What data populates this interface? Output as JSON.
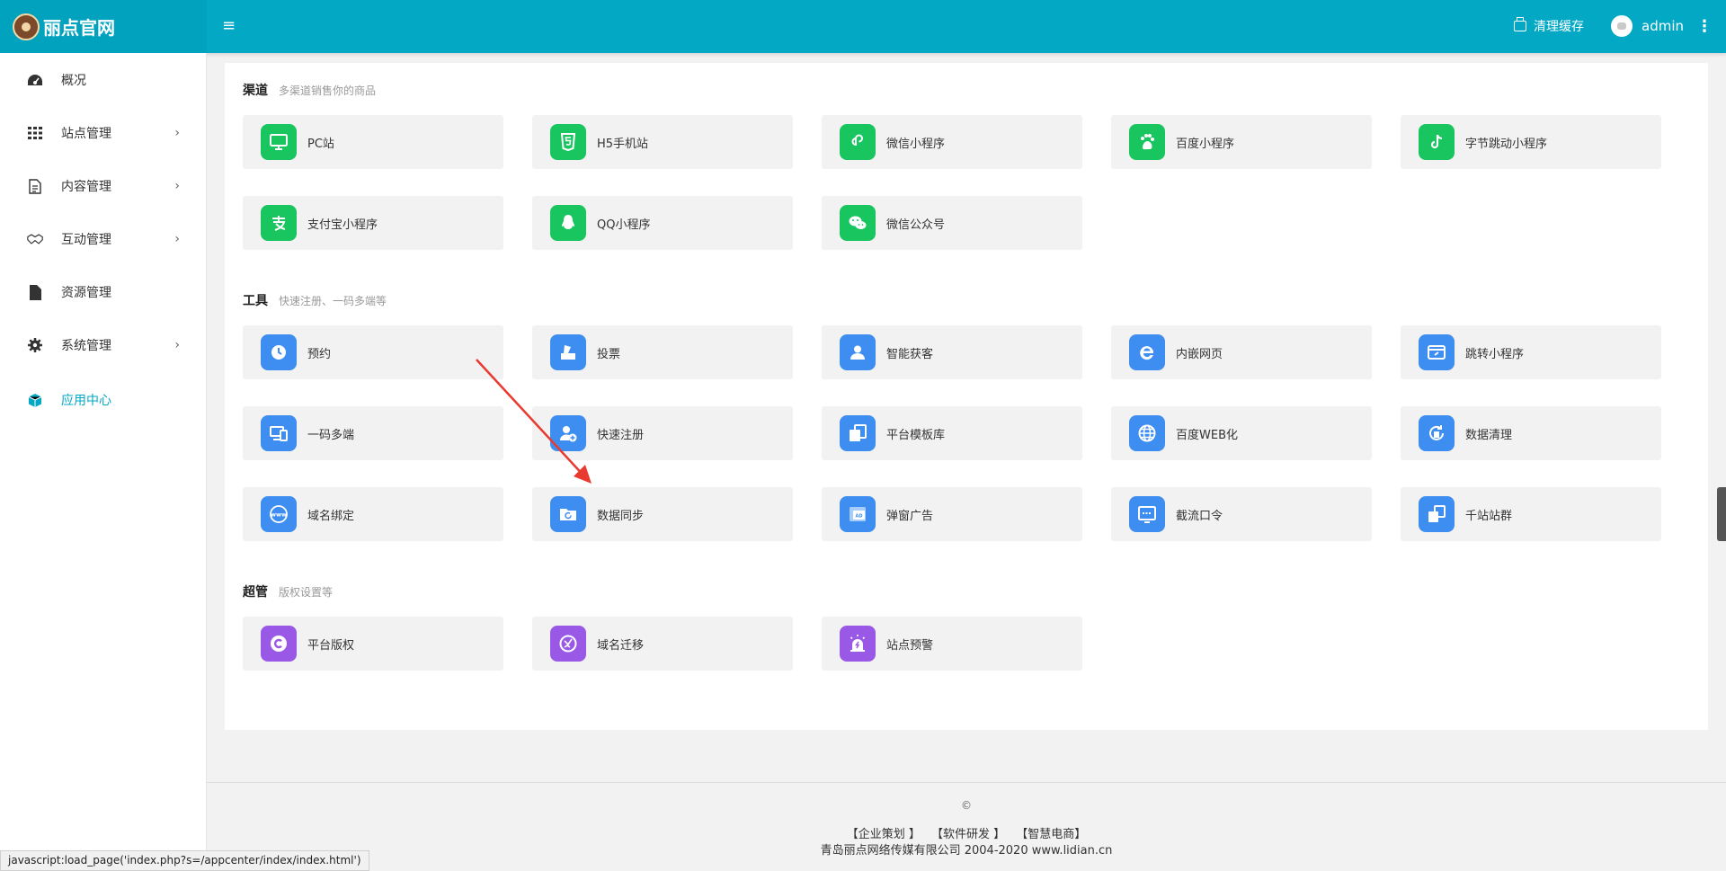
{
  "header": {
    "brand_title": "丽点官网",
    "menu_toggle_icon": "hamburger-icon",
    "clear_cache_label": "清理缓存",
    "user_name": "admin",
    "theme_color": "#03a8c4"
  },
  "sidebar": {
    "items": [
      {
        "label": "概况",
        "icon": "dashboard-icon",
        "has_submenu": false
      },
      {
        "label": "站点管理",
        "icon": "grid-icon",
        "has_submenu": true
      },
      {
        "label": "内容管理",
        "icon": "document-icon",
        "has_submenu": true
      },
      {
        "label": "互动管理",
        "icon": "handshake-icon",
        "has_submenu": true
      },
      {
        "label": "资源管理",
        "icon": "file-icon",
        "has_submenu": false
      },
      {
        "label": "系统管理",
        "icon": "gear-icon",
        "has_submenu": true
      },
      {
        "label": "应用中心",
        "icon": "cube-icon",
        "has_submenu": false,
        "active": true
      }
    ]
  },
  "sections": {
    "channels": {
      "title": "渠道",
      "subtitle": "多渠道销售你的商品",
      "color": "#18c55f",
      "items": [
        "PC站",
        "H5手机站",
        "微信小程序",
        "百度小程序",
        "字节跳动小程序",
        "支付宝小程序",
        "QQ小程序",
        "微信公众号"
      ]
    },
    "tools": {
      "title": "工具",
      "subtitle": "快速注册、一码多端等",
      "color": "#3d8ef0",
      "items": [
        "预约",
        "投票",
        "智能获客",
        "内嵌网页",
        "跳转小程序",
        "一码多端",
        "快速注册",
        "平台模板库",
        "百度WEB化",
        "数据清理",
        "域名绑定",
        "数据同步",
        "弹窗广告",
        "截流口令",
        "千站站群"
      ]
    },
    "admin": {
      "title": "超管",
      "subtitle": "版权设置等",
      "color": "#9a58e6",
      "items": [
        "平台版权",
        "域名迁移",
        "站点预警"
      ]
    }
  },
  "footer": {
    "copyright_symbol": "©",
    "links": [
      "【企业策划 】",
      "【软件研发 】",
      "【智慧电商】"
    ],
    "company": "青岛丽点网络传媒有限公司 2004-2020 www.lidian.cn"
  },
  "statusbar": {
    "text": "javascript:load_page('index.php?s=/appcenter/index/index.html')"
  }
}
